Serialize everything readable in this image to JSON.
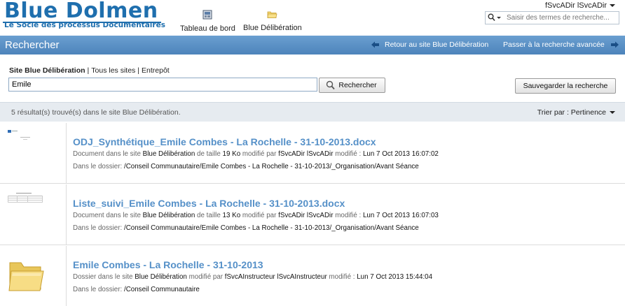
{
  "logo": {
    "title": "Blue Dolmen",
    "tagline": "Le Socle des processus Documentaires"
  },
  "app_links": [
    {
      "label": "Tableau de bord",
      "icon": "dashboard-icon"
    },
    {
      "label": "Blue Délibération",
      "icon": "folder-icon"
    }
  ],
  "user": {
    "name": "fSvcADir lSvcADir"
  },
  "header_search": {
    "placeholder": "Saisir des termes de recherche..."
  },
  "titlebar": {
    "title": "Rechercher",
    "back_label": "Retour au site Blue Délibération",
    "advanced_label": "Passer à la recherche avancée"
  },
  "scope": {
    "active": "Site Blue Délibération",
    "all_sites": "Tous les sites",
    "repository": "Entrepôt",
    "separator": "|"
  },
  "search": {
    "value": "Emile",
    "button_label": "Rechercher",
    "save_label": "Sauvegarder la recherche"
  },
  "results_bar": {
    "count_text": "5 résultat(s) trouvé(s) dans le site Blue Délibération.",
    "sort_label": "Trier par : Pertinence"
  },
  "results": [
    {
      "title": "ODJ_Synthétique_Emile Combes - La Rochelle - 31-10-2013.docx",
      "type_text": "Document dans le site",
      "site": "Blue Délibération",
      "size_prefix": "de taille",
      "size": "19 Ko",
      "modified_by_prefix": "modifié par",
      "modified_by": "fSvcADir lSvcADir",
      "modified_prefix": "modifié :",
      "modified": "Lun 7 Oct 2013 16:07:02",
      "folder_label": "Dans le dossier:",
      "folder": "/Conseil Communautaire/Emile Combes - La Rochelle - 31-10-2013/_Organisation/Avant Séance",
      "thumb": "document-thumbnail"
    },
    {
      "title": "Liste_suivi_Emile Combes - La Rochelle - 31-10-2013.docx",
      "type_text": "Document dans le site",
      "site": "Blue Délibération",
      "size_prefix": "de taille",
      "size": "13 Ko",
      "modified_by_prefix": "modifié par",
      "modified_by": "fSvcADir lSvcADir",
      "modified_prefix": "modifié :",
      "modified": "Lun 7 Oct 2013 16:07:03",
      "folder_label": "Dans le dossier:",
      "folder": "/Conseil Communautaire/Emile Combes - La Rochelle - 31-10-2013/_Organisation/Avant Séance",
      "thumb": "table-document-thumbnail"
    },
    {
      "title": "Emile Combes - La Rochelle - 31-10-2013",
      "type_text": "Dossier dans le site",
      "site": "Blue Délibération",
      "modified_by_prefix": "modifié par",
      "modified_by": "fSvcAInstructeur lSvcAInstructeur",
      "modified_prefix": "modifié :",
      "modified": "Lun 7 Oct 2013 15:44:04",
      "folder_label": "Dans le dossier:",
      "folder": "/Conseil Communautaire",
      "thumb": "folder-icon"
    }
  ],
  "colors": {
    "brand": "#1f6fae",
    "titlebar": "#5a91c6",
    "result_title": "#5590c8",
    "results_bar": "#e6ebf0"
  }
}
